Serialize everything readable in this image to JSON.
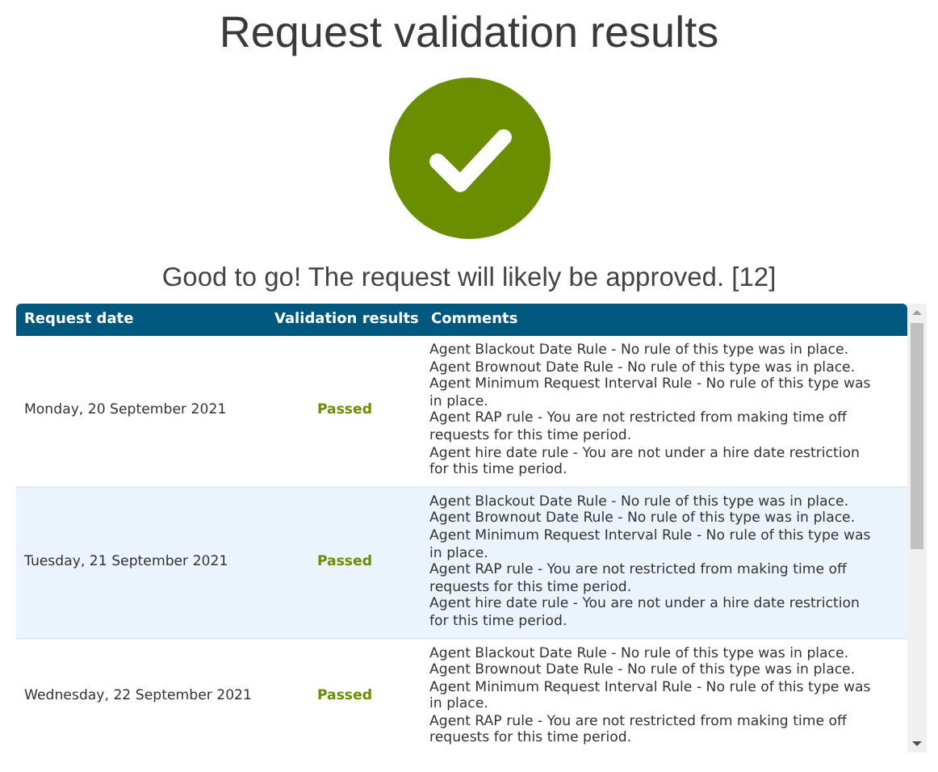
{
  "title": "Request validation results",
  "summary": "Good to go! The request will likely be approved. [12]",
  "table": {
    "columns": [
      "Request date",
      "Validation results",
      "Comments"
    ],
    "rows": [
      {
        "date": "Monday, 20 September 2021",
        "result": "Passed",
        "comments": [
          "Agent Blackout Date Rule - No rule of this type was in place.",
          "Agent Brownout Date Rule - No rule of this type was in place.",
          "Agent Minimum Request Interval Rule - No rule of this type was in place.",
          "Agent RAP rule - You are not restricted from making time off requests for this time period.",
          "Agent hire date rule - You are not under a hire date restriction for this time period."
        ]
      },
      {
        "date": "Tuesday, 21 September 2021",
        "result": "Passed",
        "comments": [
          "Agent Blackout Date Rule - No rule of this type was in place.",
          "Agent Brownout Date Rule - No rule of this type was in place.",
          "Agent Minimum Request Interval Rule - No rule of this type was in place.",
          "Agent RAP rule - You are not restricted from making time off requests for this time period.",
          "Agent hire date rule - You are not under a hire date restriction for this time period."
        ]
      },
      {
        "date": "Wednesday, 22 September 2021",
        "result": "Passed",
        "comments": [
          "Agent Blackout Date Rule - No rule of this type was in place.",
          "Agent Brownout Date Rule - No rule of this type was in place.",
          "Agent Minimum Request Interval Rule - No rule of this type was in place.",
          "Agent RAP rule - You are not restricted from making time off requests for this time period."
        ]
      }
    ]
  }
}
